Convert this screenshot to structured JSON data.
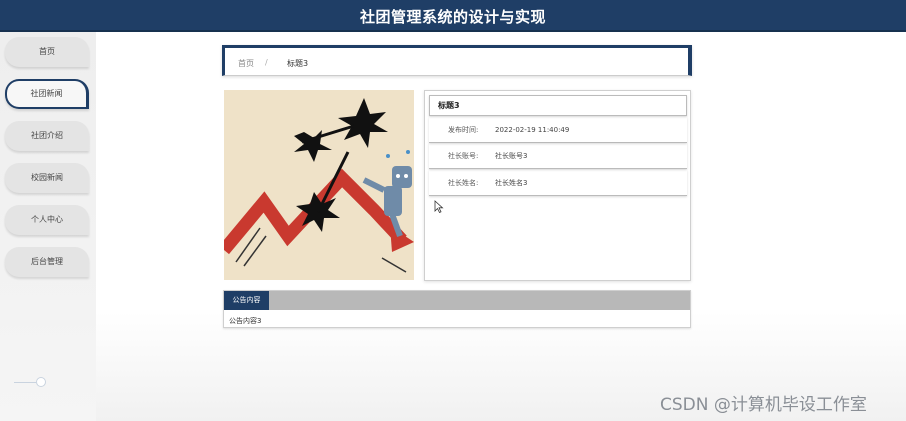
{
  "header": {
    "title": "社团管理系统的设计与实现"
  },
  "sidebar": {
    "items": [
      {
        "label": "首页"
      },
      {
        "label": "社团新闻"
      },
      {
        "label": "社团介绍"
      },
      {
        "label": "校园新闻"
      },
      {
        "label": "个人中心"
      },
      {
        "label": "后台管理"
      }
    ]
  },
  "breadcrumb": {
    "home": "首页",
    "separator": "/",
    "current": "标题3"
  },
  "article": {
    "title": "标题3",
    "fields": [
      {
        "label": "发布时间:",
        "value": "2022-02-19 11:40:49"
      },
      {
        "label": "社长账号:",
        "value": "社长账号3"
      },
      {
        "label": "社长姓名:",
        "value": "社长姓名3"
      }
    ]
  },
  "notice": {
    "tab_label": "公告内容",
    "content": "公告内容3"
  },
  "watermark": "CSDN @计算机毕设工作室",
  "colors": {
    "primary": "#1f3e66",
    "tab_bar": "#b8b8b8"
  }
}
